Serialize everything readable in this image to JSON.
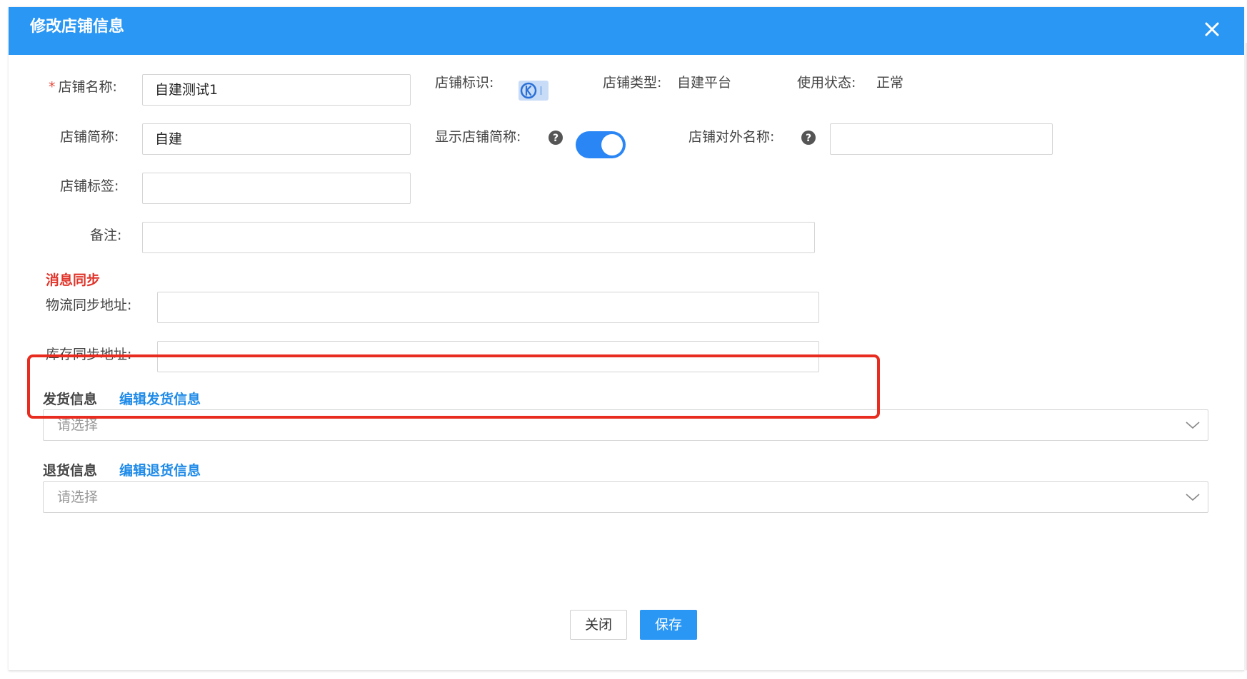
{
  "dialog": {
    "title": "修改店铺信息",
    "close_icon": "close-icon"
  },
  "form": {
    "shop_name": {
      "required_mark": "*",
      "label": "店铺名称:",
      "value": "自建测试1"
    },
    "shop_mark": {
      "label": "店铺标识:",
      "icon": "platform-logo-icon"
    },
    "shop_type": {
      "label": "店铺类型:",
      "value": "自建平台"
    },
    "status": {
      "label": "使用状态:",
      "value": "正常"
    },
    "shop_short_name": {
      "label": "店铺简称:",
      "value": "自建"
    },
    "show_short_name": {
      "label": "显示店铺简称:",
      "help_icon": "question-circle-icon",
      "enabled": true
    },
    "external_name": {
      "label": "店铺对外名称:",
      "help_icon": "question-circle-icon",
      "value": ""
    },
    "shop_tags": {
      "label": "店铺标签:",
      "value": ""
    },
    "remark": {
      "label": "备注:",
      "value": ""
    }
  },
  "message_sync": {
    "title": "消息同步",
    "logistics_url": {
      "label": "物流同步地址:",
      "value": ""
    },
    "inventory_url": {
      "label": "库存同步地址:",
      "value": ""
    }
  },
  "shipping": {
    "title": "发货信息",
    "edit_link": "编辑发货信息",
    "placeholder": "请选择"
  },
  "returns": {
    "title": "退货信息",
    "edit_link": "编辑退货信息",
    "placeholder": "请选择"
  },
  "footer": {
    "close_label": "关闭",
    "save_label": "保存"
  },
  "colors": {
    "header": "#2a97f5",
    "link": "#1f8be8",
    "required": "#e64a3c",
    "highlight_border": "#e82c1f",
    "toggle_on": "#2a86f5"
  }
}
